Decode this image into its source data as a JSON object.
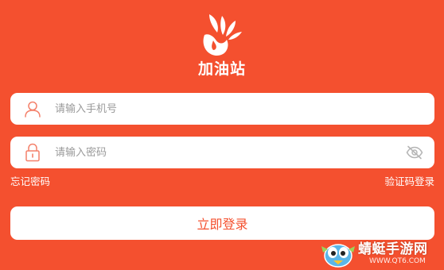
{
  "app": {
    "logo_text": "加油站"
  },
  "login_form": {
    "phone_placeholder": "请输入手机号",
    "password_placeholder": "请输入密码",
    "forgot_password_label": "忘记密码",
    "sms_login_label": "验证码登录",
    "login_button_label": "立即登录"
  },
  "icons": {
    "phone_field_icon": "user-icon",
    "password_field_icon": "lock-icon",
    "password_toggle_icon": "eye-off-icon"
  },
  "watermark": {
    "name": "蜻蜓手游网",
    "url": "WWW.QT6.COM"
  },
  "colors": {
    "background": "#F4502F",
    "field_background": "#FFFFFF",
    "button_text": "#F4502F",
    "placeholder": "#9A9A9A"
  }
}
